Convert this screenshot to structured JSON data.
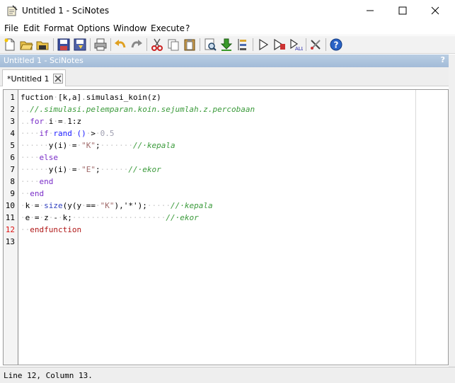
{
  "window": {
    "title": "Untitled 1 - SciNotes",
    "minimize_icon": "minimize-icon",
    "maximize_icon": "maximize-icon",
    "close_icon": "close-icon"
  },
  "menu": [
    "File",
    "Edit",
    "Format",
    "Options",
    "Window",
    "Execute",
    "?"
  ],
  "toolbar": {
    "icons": [
      "new-file-icon",
      "open-file-icon",
      "open-in-new-icon",
      "save-icon",
      "save-as-icon",
      "print-icon",
      "undo-icon",
      "redo-icon",
      "cut-icon",
      "copy-icon",
      "paste-icon",
      "find-replace-icon",
      "download-icon",
      "list-icon",
      "run-icon",
      "run-with-echo-icon",
      "run-file-icon",
      "settings-icon",
      "help-icon"
    ]
  },
  "dock": {
    "title": "Untitled 1 - SciNotes",
    "help": "?"
  },
  "tab": {
    "label": "*Untitled 1"
  },
  "editor": {
    "line_numbers": [
      "1",
      "2",
      "3",
      "4",
      "5",
      "6",
      "7",
      "8",
      "9",
      "10",
      "11",
      "12",
      "13"
    ],
    "current_line": "12",
    "lines": [
      [
        [
          "t",
          "fuction"
        ],
        [
          "d",
          "·"
        ],
        [
          "t",
          "[k,a]"
        ],
        [
          "g",
          "."
        ],
        [
          "t",
          "simulasi_koin(z)"
        ]
      ],
      [
        [
          "d",
          ".."
        ],
        [
          "c",
          "//.simulasi.pelemparan.koin.sejumlah.z.percobaan"
        ]
      ],
      [
        [
          "d",
          ".."
        ],
        [
          "k",
          "for"
        ],
        [
          "d",
          "."
        ],
        [
          "t",
          "i"
        ],
        [
          "d",
          "·"
        ],
        [
          "t",
          "="
        ],
        [
          "d",
          "."
        ],
        [
          "t",
          "1:z"
        ]
      ],
      [
        [
          "d",
          "····"
        ],
        [
          "k",
          "if"
        ],
        [
          "d",
          "·"
        ],
        [
          "b",
          "rand"
        ],
        [
          "d",
          "·"
        ],
        [
          "b",
          "()"
        ],
        [
          "d",
          "·"
        ],
        [
          "t",
          ">"
        ],
        [
          "d",
          "·"
        ],
        [
          "n",
          "0.5"
        ]
      ],
      [
        [
          "d",
          "······"
        ],
        [
          "t",
          "y(i)"
        ],
        [
          "d",
          "·"
        ],
        [
          "t",
          "="
        ],
        [
          "d",
          "·"
        ],
        [
          "s",
          "\"K\""
        ],
        [
          "t",
          ";"
        ],
        [
          "d",
          "·······"
        ],
        [
          "c",
          "//·kepala"
        ]
      ],
      [
        [
          "d",
          "····"
        ],
        [
          "k",
          "else"
        ]
      ],
      [
        [
          "d",
          "······"
        ],
        [
          "t",
          "y(i)"
        ],
        [
          "d",
          "·"
        ],
        [
          "t",
          "="
        ],
        [
          "d",
          "·"
        ],
        [
          "s",
          "\"E\""
        ],
        [
          "t",
          ";"
        ],
        [
          "d",
          "······"
        ],
        [
          "c",
          "//·ekor"
        ]
      ],
      [
        [
          "d",
          "····"
        ],
        [
          "k",
          "end"
        ]
      ],
      [
        [
          "d",
          "··"
        ],
        [
          "k",
          "end"
        ]
      ],
      [
        [
          "d",
          "·"
        ],
        [
          "t",
          "k"
        ],
        [
          "d",
          "·"
        ],
        [
          "t",
          "="
        ],
        [
          "d",
          "·"
        ],
        [
          "f",
          "size"
        ],
        [
          "t",
          "(y(y"
        ],
        [
          "d",
          "·"
        ],
        [
          "t",
          "=="
        ],
        [
          "d",
          "·"
        ],
        [
          "s",
          "\"K\""
        ],
        [
          "t",
          "),'*');"
        ],
        [
          "d",
          "·····"
        ],
        [
          "c",
          "//·kepala"
        ]
      ],
      [
        [
          "d",
          "·"
        ],
        [
          "t",
          "e"
        ],
        [
          "d",
          "·"
        ],
        [
          "t",
          "="
        ],
        [
          "d",
          "·"
        ],
        [
          "t",
          "z"
        ],
        [
          "d",
          "·"
        ],
        [
          "t",
          "-"
        ],
        [
          "d",
          "·"
        ],
        [
          "t",
          "k;"
        ],
        [
          "d",
          "····················"
        ],
        [
          "c",
          "//·ekor"
        ]
      ],
      [
        [
          "d",
          "··"
        ],
        [
          "r",
          "endfunction"
        ]
      ],
      []
    ]
  },
  "status": {
    "text": "Line 12, Column 13."
  }
}
